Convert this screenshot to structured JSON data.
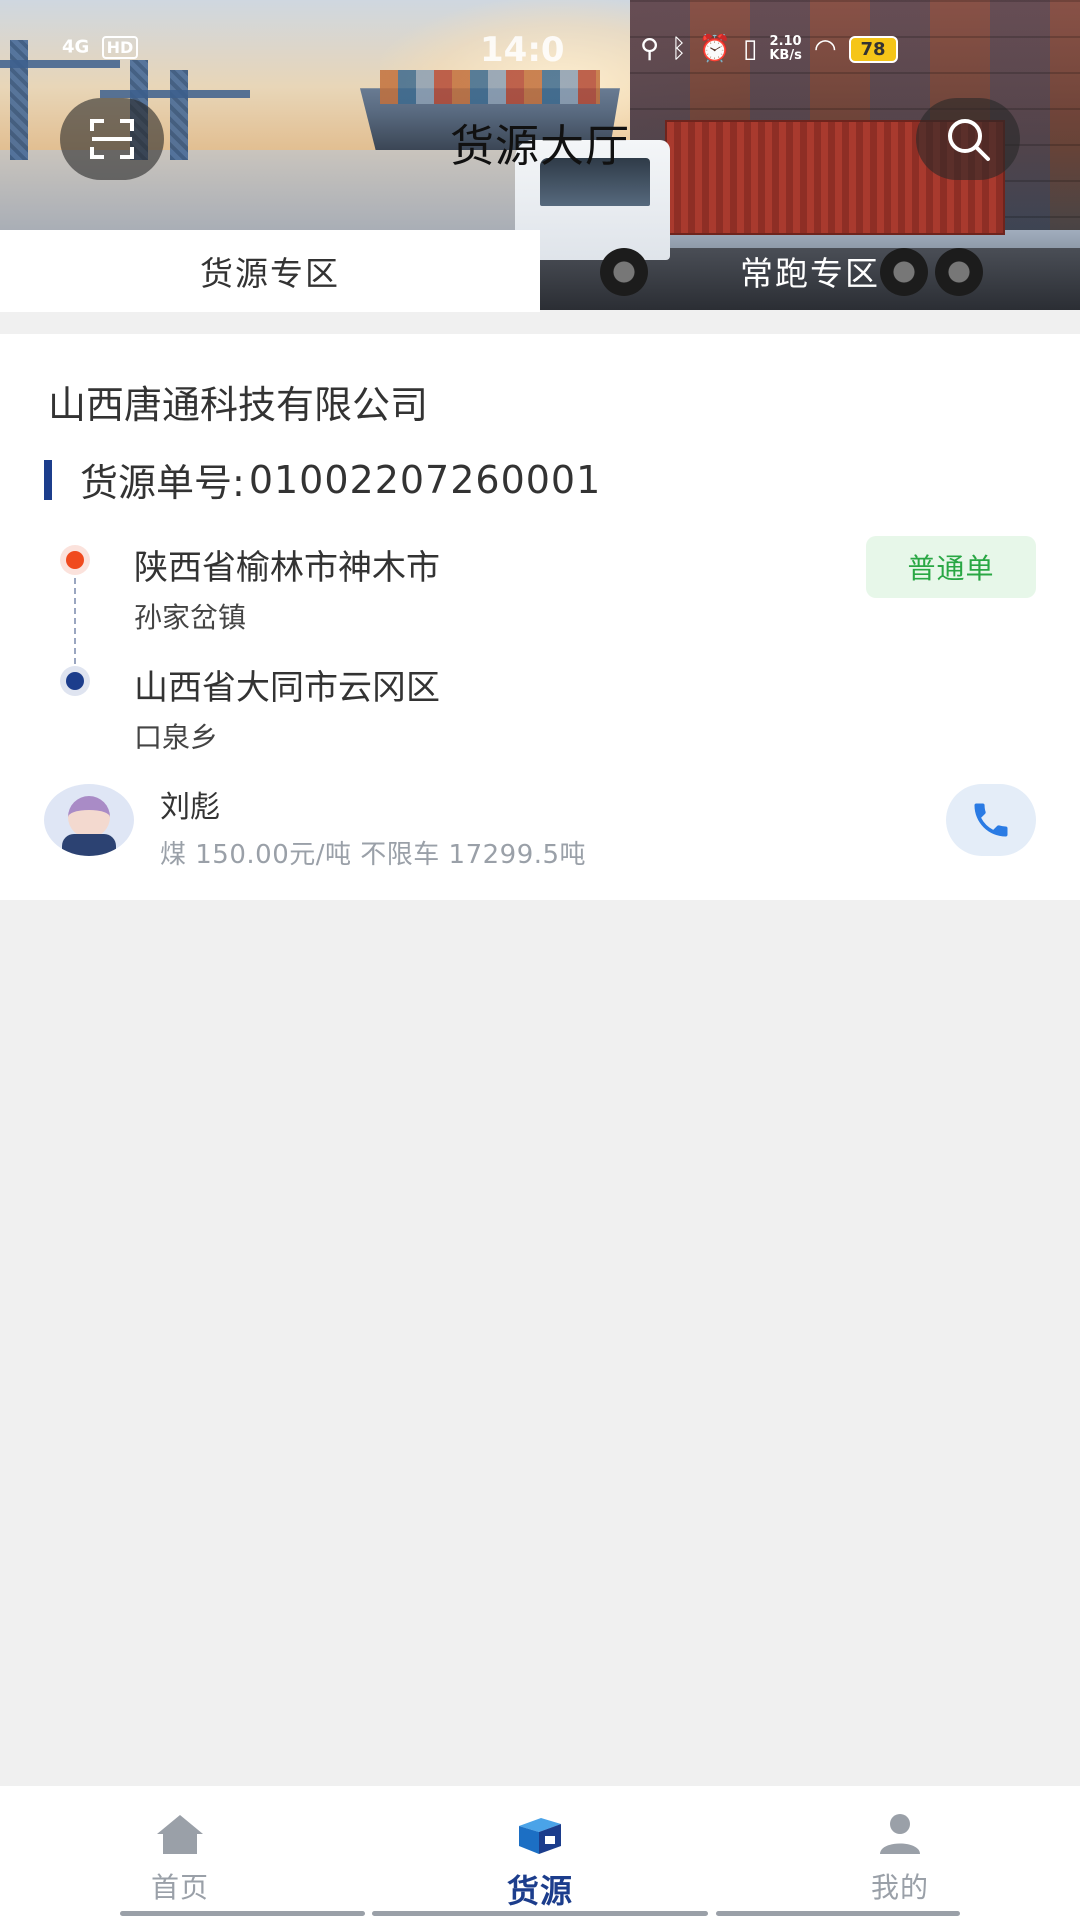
{
  "status_bar": {
    "signal": "4G",
    "hd": "HD",
    "time": "14:0",
    "speed_top": "2.10",
    "speed_bottom": "KB/s",
    "battery": "78"
  },
  "header": {
    "title": "货源大厅",
    "left_icon": "scan-icon",
    "right_icon": "search-icon"
  },
  "tabs": [
    {
      "label": "货源专区",
      "active": true
    },
    {
      "label": "常跑专区",
      "active": false
    }
  ],
  "card": {
    "company": "山西唐通科技有限公司",
    "order_label": "货源单号:",
    "order_no": "01002207260001",
    "from": {
      "main": "陕西省榆林市神木市",
      "sub": "孙家岔镇"
    },
    "to": {
      "main": "山西省大同市云冈区",
      "sub": "口泉乡"
    },
    "badge": "普通单",
    "contact_name": "刘彪",
    "cargo_info": "煤 150.00元/吨 不限车 17299.5吨"
  },
  "colors": {
    "accent": "#1c3d8c",
    "start_dot": "#f04a1e",
    "badge_text": "#29a744",
    "badge_bg": "#e7f7e9",
    "phone": "#2a7be4"
  },
  "bottom_nav": [
    {
      "label": "首页",
      "icon": "home-icon",
      "active": false
    },
    {
      "label": "货源",
      "icon": "cargo-box-icon",
      "active": true
    },
    {
      "label": "我的",
      "icon": "user-icon",
      "active": false
    }
  ]
}
